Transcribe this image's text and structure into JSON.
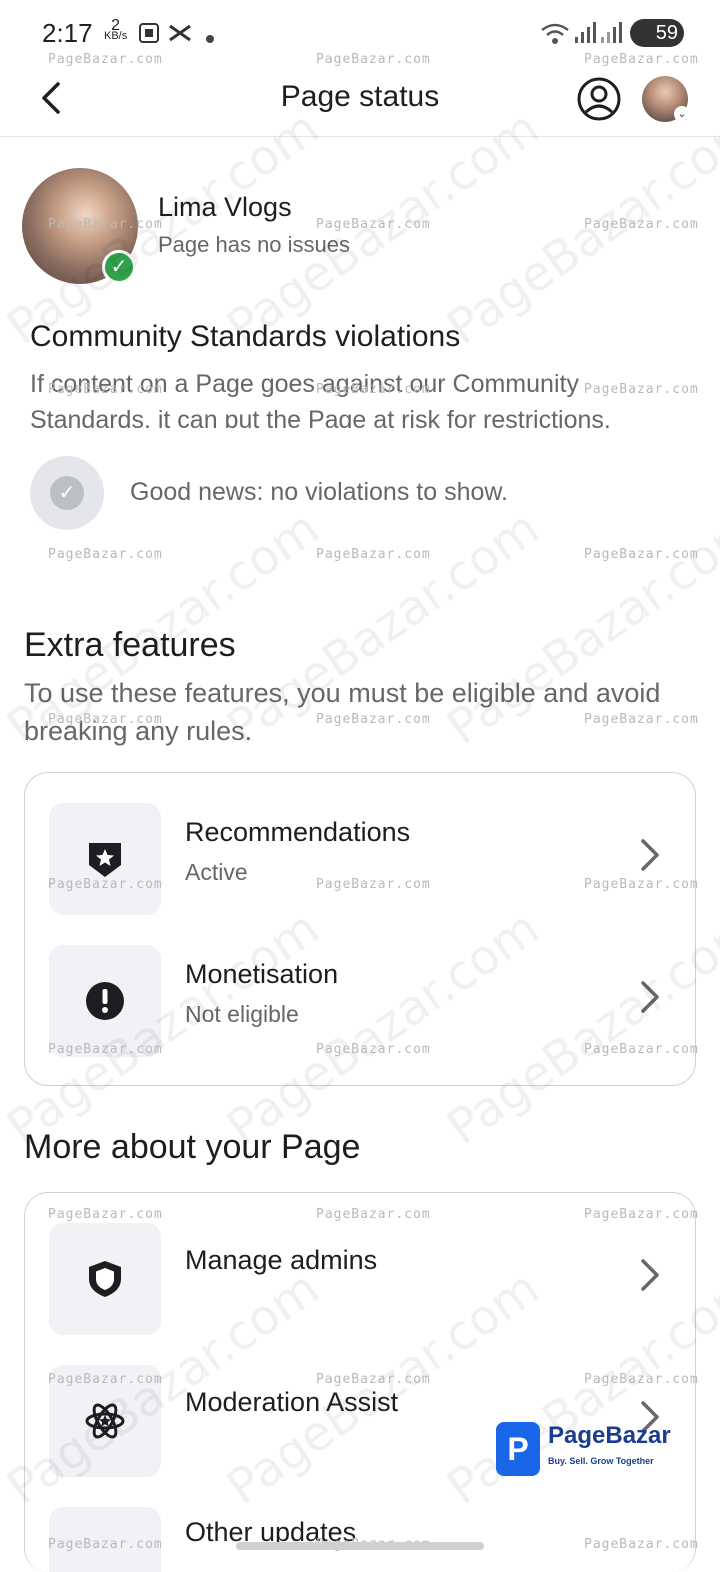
{
  "status_bar": {
    "time": "2:17",
    "net_speed": "2",
    "net_unit": "KB/s",
    "battery": "59"
  },
  "header": {
    "title": "Page status"
  },
  "page": {
    "name": "Lima Vlogs",
    "status": "Page has no issues"
  },
  "community": {
    "title": "Community Standards violations",
    "description": "If content on a Page goes against our Community Standards, it can put the Page at risk for restrictions.",
    "good_news": "Good news: no violations to show."
  },
  "extra_features": {
    "title": "Extra features",
    "description": "To use these features, you must be eligible and avoid breaking any rules.",
    "items": [
      {
        "label": "Recommendations",
        "status": "Active",
        "icon": "star-shield-icon"
      },
      {
        "label": "Monetisation",
        "status": "Not eligible",
        "icon": "alert-dollar-icon"
      }
    ]
  },
  "more_about": {
    "title": "More about your Page",
    "items": [
      {
        "label": "Manage admins",
        "icon": "shield-icon"
      },
      {
        "label": "Moderation Assist",
        "icon": "atom-star-icon"
      },
      {
        "label": "Other updates",
        "icon": "updates-icon"
      }
    ]
  },
  "watermark": {
    "text": "PageBazar.com",
    "small_text": "PageBazar.com"
  },
  "brand": {
    "name": "PageBazar",
    "tagline": "Buy. Sell. Grow Together"
  }
}
